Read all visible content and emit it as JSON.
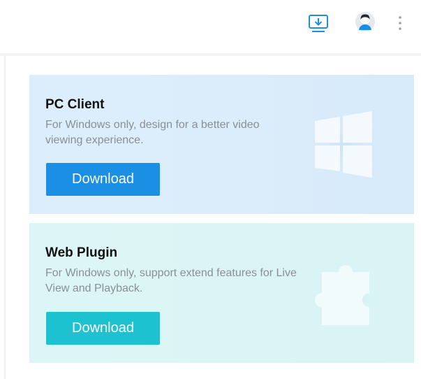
{
  "header": {
    "download_icon": "download-icon",
    "avatar_icon": "user-avatar-icon",
    "more_icon": "more-vertical-icon"
  },
  "cards": [
    {
      "title": "PC Client",
      "description": "For Windows only, design for a better video viewing experience.",
      "button_label": "Download",
      "icon": "windows-logo-icon",
      "accent": "#1a8fe3",
      "background": "#dceefc"
    },
    {
      "title": "Web Plugin",
      "description": "For Windows only, support extend features for Live View and Playback.",
      "button_label": "Download",
      "icon": "puzzle-piece-icon",
      "accent": "#1cc2cf",
      "background": "#dcf6f7"
    }
  ],
  "colors": {
    "header_icon": "#1a8fe3",
    "title_text": "#111111",
    "description_text": "#8a8f96"
  }
}
